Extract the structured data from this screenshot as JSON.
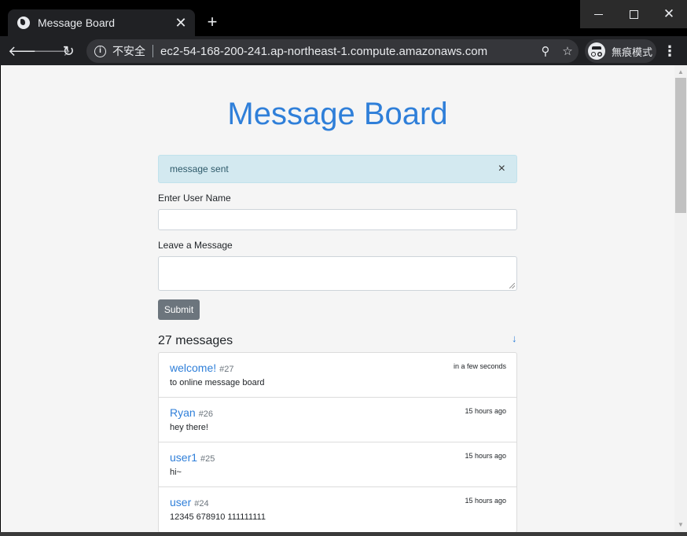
{
  "browser": {
    "tab_title": "Message Board",
    "tab_close": "✕",
    "new_tab": "+",
    "security_label": "不安全",
    "url": "ec2-54-168-200-241.ap-northeast-1.compute.amazonaws.com",
    "incognito_label": "無痕模式"
  },
  "page": {
    "title": "Message Board",
    "alert_text": "message sent",
    "alert_close": "×",
    "username_label": "Enter User Name",
    "username_value": "",
    "message_label": "Leave a Message",
    "message_value": "",
    "submit_label": "Submit",
    "message_count": "27 messages",
    "sort_arrow": "↓"
  },
  "messages": [
    {
      "name": "welcome!",
      "id": "#27",
      "time": "in a few seconds",
      "body": "to online message board"
    },
    {
      "name": "Ryan",
      "id": "#26",
      "time": "15 hours ago",
      "body": "hey there!"
    },
    {
      "name": "user1",
      "id": "#25",
      "time": "15 hours ago",
      "body": "hi~"
    },
    {
      "name": "user",
      "id": "#24",
      "time": "15 hours ago",
      "body": "12345 678910 111111111"
    }
  ],
  "colors": {
    "accent": "#2f7fd9",
    "alert_bg": "#d3e9f0",
    "button_bg": "#6c757d"
  }
}
